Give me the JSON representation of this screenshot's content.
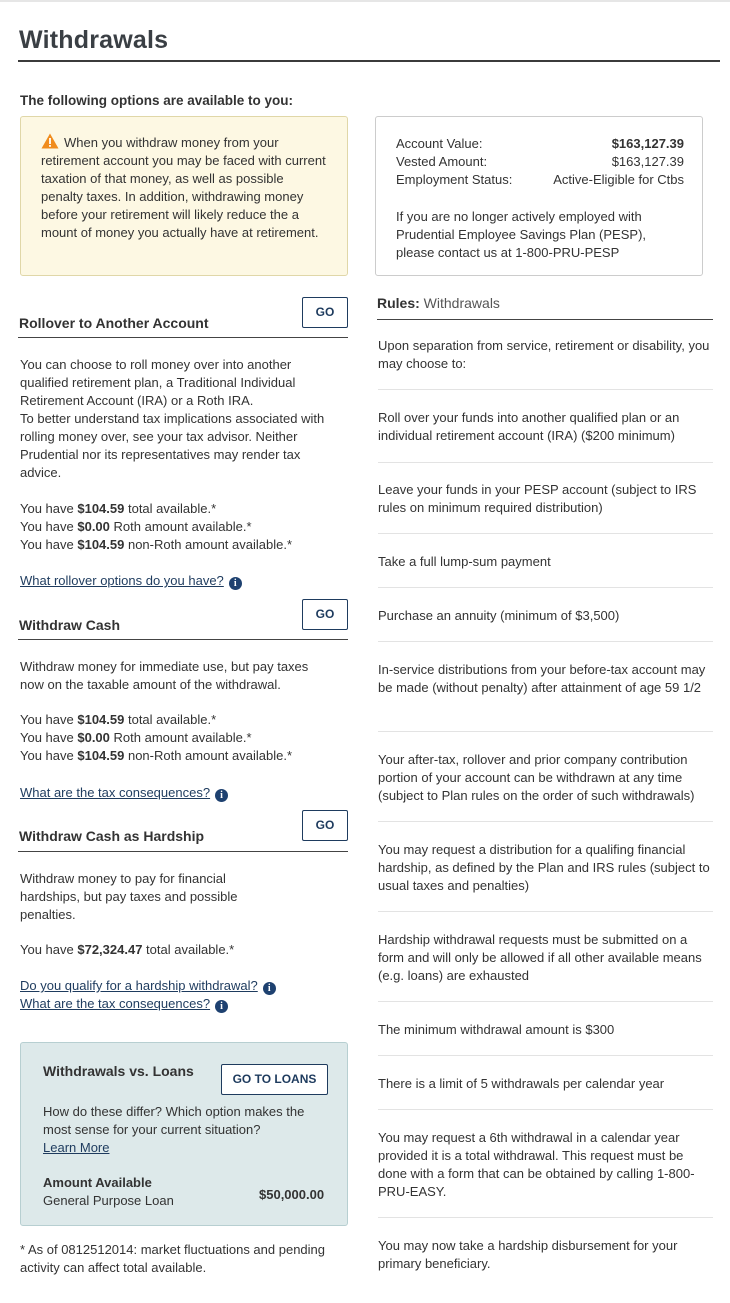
{
  "page_title": "Withdrawals",
  "subtitle": "The following options are available to you:",
  "warning": {
    "text": "When you withdraw money from your retirement account you may be faced with current taxation of that money, as well as possible penalty taxes. In addition, withdrawing money before your retirement will likely reduce the a mount of money you actually have at retirement."
  },
  "account": {
    "rows": [
      {
        "label": "Account Value:",
        "value": "$163,127.39"
      },
      {
        "label": "Vested Amount:",
        "value": "$163,127.39"
      },
      {
        "label": "Employment Status:",
        "value": "Active-Eligible for Ctbs"
      }
    ],
    "note": "If you are no longer actively employed with Prudential Employee Savings Plan (PESP), please contact us at 1-800-PRU-PESP"
  },
  "rollover": {
    "title": "Rollover to Another Account",
    "go_label": "GO",
    "desc": "You can choose to roll money over into another qualified retirement plan, a Traditional Individual Retirement Account (IRA) or a Roth IRA.\nTo better understand tax implications associated with rolling money over, see your tax advisor. Neither Prudential nor its representatives may render tax advice.",
    "avail": [
      {
        "pre": "You have ",
        "amt": "$104.59",
        "post": " total available.*"
      },
      {
        "pre": "You have ",
        "amt": "$0.00",
        "post": " Roth amount available.*"
      },
      {
        "pre": "You have ",
        "amt": "$104.59",
        "post": " non-Roth amount available.*"
      }
    ],
    "link": "What rollover options do you have?"
  },
  "cash": {
    "title": "Withdraw Cash",
    "go_label": "GO",
    "desc": "Withdraw money for immediate use, but pay taxes now on the taxable amount of the withdrawal.",
    "avail": [
      {
        "pre": "You have ",
        "amt": "$104.59",
        "post": " total available.*"
      },
      {
        "pre": "You have ",
        "amt": "$0.00",
        "post": " Roth amount available.*"
      },
      {
        "pre": "You have ",
        "amt": "$104.59",
        "post": " non-Roth amount available.*"
      }
    ],
    "link": "What are the tax consequences?"
  },
  "hardship": {
    "title": "Withdraw Cash as Hardship",
    "go_label": "GO",
    "desc": "Withdraw money to pay for financial hardships, but pay taxes and possible penalties.",
    "avail": [
      {
        "pre": "You have ",
        "amt": "$72,324.47",
        "post": " total available.*"
      }
    ],
    "link1": "Do you qualify for a hardship withdrawal?",
    "link2": "What are the tax consequences?"
  },
  "loans": {
    "title": "Withdrawals vs. Loans",
    "button": "GO TO LOANS",
    "desc": "How do these differ? Which option makes the most sense for your current situation?",
    "learn_more": "Learn More",
    "amount_head": "Amount Available",
    "amount_label": "General Purpose Loan",
    "amount_value": "$50,000.00"
  },
  "footnote": "* As of 0812512014: market fluctuations and pending activity can affect total available.",
  "rules": {
    "head_bold": "Rules:",
    "head_rest": " Withdrawals",
    "items": [
      "Upon separation from service, retirement or disability, you may choose to:",
      "Roll over your funds into another qualified plan or an individual retirement account (IRA) ($200 minimum)",
      "Leave your funds in your PESP account (subject to IRS rules on minimum required distribution)",
      "Take a full lump-sum payment",
      "Purchase an annuity (minimum of $3,500)",
      "In-service distributions from your before-tax account may be made (without penalty) after attainment of age 59 1/2",
      "Your after-tax, rollover and prior company contribution portion of your account can be withdrawn at any time (subject to Plan rules on the order of such withdrawals)",
      "You may request a distribution for a qualifing financial hardship, as defined by the Plan and IRS rules (subject to usual taxes and penalties)",
      "Hardship withdrawal requests must be submitted on a form and will only be allowed if all other available means (e.g. loans) are exhausted",
      "The minimum withdrawal amount is $300",
      "There is a limit of 5 withdrawals per calendar year",
      "You may request a 6th withdrawal in a calendar year provided it is a total withdrawal. This request must be done with a form that can be obtained by calling 1-800-PRU-EASY.",
      "You may now take a hardship disbursement for your primary beneficiary."
    ]
  }
}
